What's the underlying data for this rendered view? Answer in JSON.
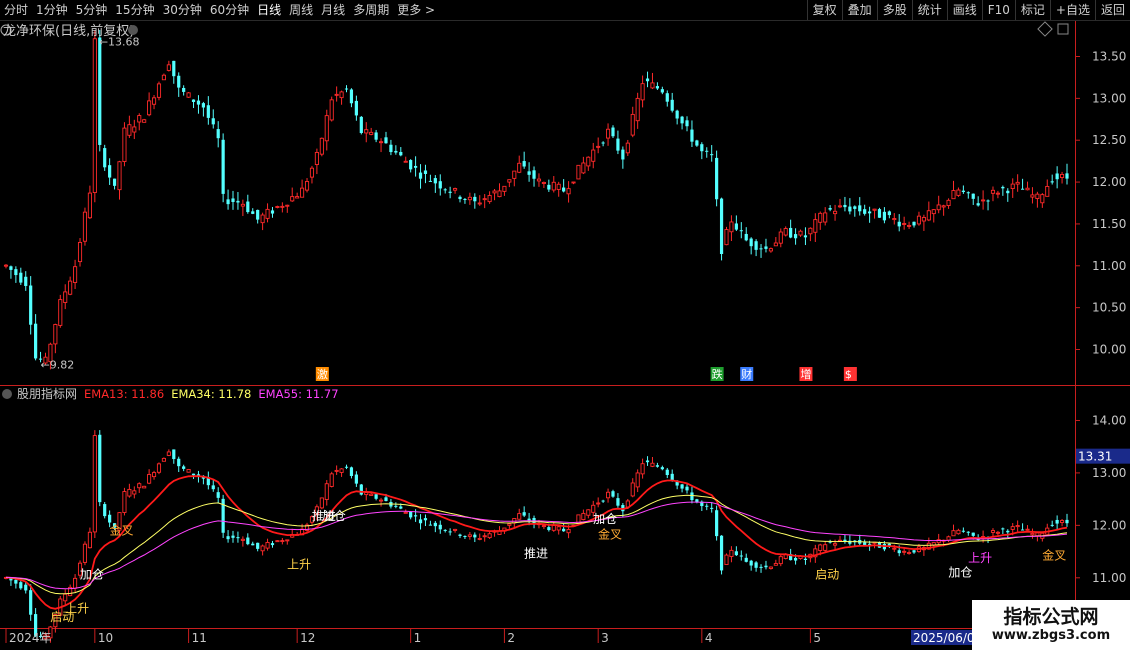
{
  "toolbar": {
    "periods": [
      {
        "label": "分时",
        "active": false
      },
      {
        "label": "1分钟",
        "active": false
      },
      {
        "label": "5分钟",
        "active": false
      },
      {
        "label": "15分钟",
        "active": false
      },
      {
        "label": "30分钟",
        "active": false
      },
      {
        "label": "60分钟",
        "active": false
      },
      {
        "label": "日线",
        "active": true
      },
      {
        "label": "周线",
        "active": false
      },
      {
        "label": "月线",
        "active": false
      },
      {
        "label": "多周期",
        "active": false
      },
      {
        "label": "更多 >",
        "active": false
      }
    ],
    "right_buttons": [
      "复权",
      "叠加",
      "多股",
      "统计",
      "画线",
      "F10",
      "标记",
      "+自选",
      "返回"
    ]
  },
  "colors": {
    "up": "#ff2a2a",
    "down": "#54ffff",
    "ema13": "#ff1a1a",
    "ema34": "#ffff66",
    "ema55": "#ff44ff",
    "axis": "#c81e1e",
    "text": "#c8c8c8"
  },
  "price_pane": {
    "title": "龙净环保(日线,前复权)",
    "high_label": "13.68",
    "low_label": "9.82",
    "yticks": [
      "13.50",
      "13.00",
      "12.50",
      "12.00",
      "11.50",
      "11.00",
      "10.50",
      "10.00"
    ],
    "event_markers": [
      {
        "label": "激",
        "index": 64,
        "color": "#ff8c00"
      },
      {
        "label": "跌",
        "index": 144,
        "color": "#1e9e2e"
      },
      {
        "label": "财",
        "index": 150,
        "color": "#3a7cff"
      },
      {
        "label": "增",
        "index": 162,
        "color": "#ff3333"
      },
      {
        "label": "$",
        "index": 171,
        "color": "#ff3333"
      }
    ]
  },
  "indicator_pane": {
    "title": "股朋指标网",
    "ema_labels": [
      {
        "text": "EMA13: 11.86",
        "color": "#ff2a2a"
      },
      {
        "text": "EMA34: 11.78",
        "color": "#ffff66"
      },
      {
        "text": "EMA55: 11.77",
        "color": "#ff44ff"
      }
    ],
    "yticks": [
      "14.00",
      "13.00",
      "12.00",
      "11.00"
    ],
    "current_value": "13.31",
    "signals": [
      {
        "text": "启动",
        "index": 11,
        "color": "#ffd24a"
      },
      {
        "text": "上升",
        "index": 14,
        "color": "#ffd24a"
      },
      {
        "text": "加仓",
        "index": 17,
        "color": "#ffffff"
      },
      {
        "text": "金叉",
        "index": 23,
        "color": "#ffaa33"
      },
      {
        "text": "上升",
        "index": 59,
        "color": "#ffd24a"
      },
      {
        "text": "加仓",
        "index": 66,
        "color": "#ffffff"
      },
      {
        "text": "推进",
        "index": 64,
        "color": "#ffffff"
      },
      {
        "text": "推进",
        "index": 107,
        "color": "#ffffff"
      },
      {
        "text": "金叉",
        "index": 122,
        "color": "#ffaa33"
      },
      {
        "text": "加仓",
        "index": 121,
        "color": "#ffffff"
      },
      {
        "text": "启动",
        "index": 166,
        "color": "#ffd24a"
      },
      {
        "text": "加仓",
        "index": 193,
        "color": "#ffffff"
      },
      {
        "text": "上升",
        "index": 197,
        "color": "#ff44ff"
      },
      {
        "text": "金叉",
        "index": 212,
        "color": "#ffaa33"
      }
    ]
  },
  "time_axis": {
    "labels": [
      {
        "text": "2024年",
        "index": 0
      },
      {
        "text": "10",
        "index": 18
      },
      {
        "text": "11",
        "index": 37
      },
      {
        "text": "12",
        "index": 59
      },
      {
        "text": "1",
        "index": 82
      },
      {
        "text": "2",
        "index": 101
      },
      {
        "text": "3",
        "index": 120
      },
      {
        "text": "4",
        "index": 141
      },
      {
        "text": "5",
        "index": 163
      }
    ],
    "cursor_date": "2025/06/03"
  },
  "watermark": {
    "title": "指标公式网",
    "url": "www.zbgs3.com"
  },
  "chart_data": {
    "type": "candlestick",
    "title": "龙净环保(日线,前复权)",
    "price_ylim": [
      9.6,
      13.9
    ],
    "indicator_ylim": [
      10.1,
      14.6
    ],
    "anchors": [
      [
        0,
        11.0
      ],
      [
        4,
        10.8
      ],
      [
        6,
        9.9
      ],
      [
        8,
        9.85
      ],
      [
        11,
        10.55
      ],
      [
        14,
        11.0
      ],
      [
        17,
        11.9
      ],
      [
        18,
        13.68
      ],
      [
        19,
        12.4
      ],
      [
        22,
        11.9
      ],
      [
        24,
        12.6
      ],
      [
        28,
        12.8
      ],
      [
        33,
        13.45
      ],
      [
        35,
        13.1
      ],
      [
        40,
        12.9
      ],
      [
        43,
        12.5
      ],
      [
        44,
        11.8
      ],
      [
        48,
        11.75
      ],
      [
        51,
        11.55
      ],
      [
        55,
        11.7
      ],
      [
        60,
        11.9
      ],
      [
        63,
        12.3
      ],
      [
        66,
        13.0
      ],
      [
        69,
        13.1
      ],
      [
        72,
        12.6
      ],
      [
        76,
        12.5
      ],
      [
        80,
        12.3
      ],
      [
        84,
        12.1
      ],
      [
        90,
        11.9
      ],
      [
        95,
        11.75
      ],
      [
        100,
        11.9
      ],
      [
        104,
        12.2
      ],
      [
        108,
        12.0
      ],
      [
        113,
        11.9
      ],
      [
        118,
        12.3
      ],
      [
        122,
        12.6
      ],
      [
        125,
        12.3
      ],
      [
        129,
        13.2
      ],
      [
        133,
        13.1
      ],
      [
        137,
        12.7
      ],
      [
        141,
        12.35
      ],
      [
        143,
        12.3
      ],
      [
        145,
        11.2
      ],
      [
        147,
        11.55
      ],
      [
        150,
        11.3
      ],
      [
        154,
        11.2
      ],
      [
        158,
        11.4
      ],
      [
        162,
        11.35
      ],
      [
        166,
        11.65
      ],
      [
        170,
        11.7
      ],
      [
        174,
        11.65
      ],
      [
        178,
        11.6
      ],
      [
        182,
        11.5
      ],
      [
        186,
        11.55
      ],
      [
        190,
        11.75
      ],
      [
        193,
        11.9
      ],
      [
        197,
        11.75
      ],
      [
        201,
        11.9
      ],
      [
        205,
        11.95
      ],
      [
        209,
        11.8
      ],
      [
        212,
        12.05
      ]
    ]
  }
}
